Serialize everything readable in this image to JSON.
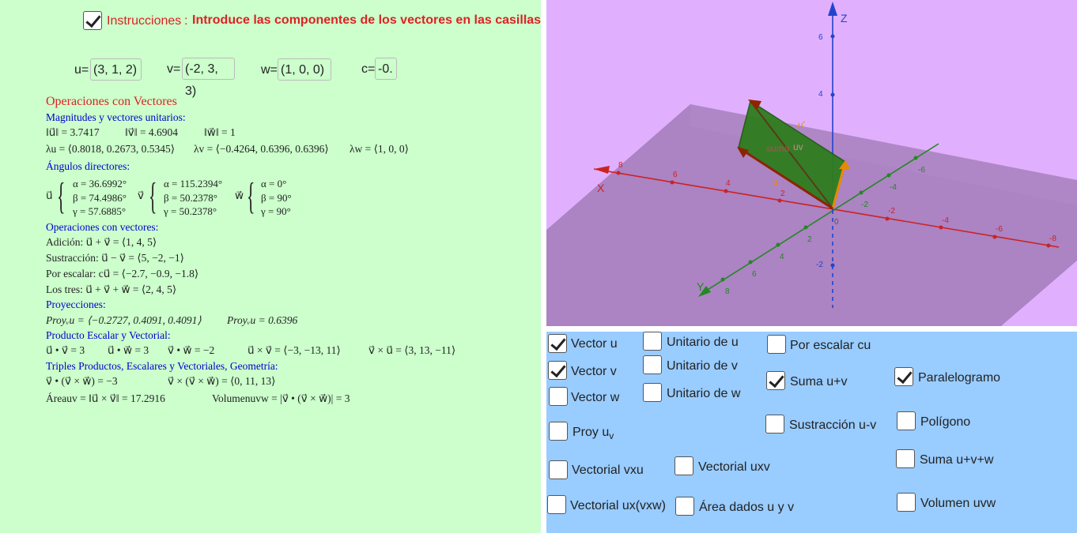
{
  "header": {
    "checkbox_checked": true,
    "label": "Instrucciones",
    "sep": ":",
    "instruction": "Introduce las componentes de los vectores en las casillas"
  },
  "inputs": [
    {
      "label": "u=",
      "value": "(3, 1, 2)"
    },
    {
      "label": "v=",
      "value": "(-2, 3, 3)"
    },
    {
      "label": "w=",
      "value": "(1, 0, 0)"
    },
    {
      "label": "c=",
      "value": "-0."
    }
  ],
  "ops": {
    "title": "Operaciones con Vectores",
    "magnitudes_title": "Magnitudes y vectores unitarios:",
    "mag_u": "‖u⃗‖ = 3.7417",
    "mag_v": "‖v⃗‖ = 4.6904",
    "mag_w": "‖w⃗‖ = 1",
    "lambda_u": "λu = ⟨0.8018, 0.2673, 0.5345⟩",
    "lambda_v": "λv = ⟨−0.4264, 0.6396, 0.6396⟩",
    "lambda_w": "λw = ⟨1, 0, 0⟩",
    "angles_title": "Ángulos directores:",
    "angles_u": [
      "α = 36.6992°",
      "β = 74.4986°",
      "γ = 57.6885°"
    ],
    "angles_v": [
      "α = 115.2394°",
      "β = 50.2378°",
      "γ = 50.2378°"
    ],
    "angles_w": [
      "α = 0°",
      "β = 90°",
      "γ = 90°"
    ],
    "vec_u": "u⃗",
    "vec_v": "v⃗",
    "vec_w": "w⃗",
    "opv_title": "Operaciones con vectores:",
    "add": "Adición: u⃗ + v⃗ = ⟨1, 4, 5⟩",
    "sub": "Sustracción: u⃗ − v⃗ = ⟨5, −2, −1⟩",
    "scalar": "Por escalar: cu⃗ = ⟨−2.7, −0.9, −1.8⟩",
    "three": "Los tres: u⃗ + v⃗ + w⃗ = ⟨2, 4, 5⟩",
    "proj_title": "Proyecciones:",
    "proj_vec": "Proyᵥu = ⟨−0.2727, 0.4091, 0.4091⟩",
    "proj_scalar": "Proyᵥu = 0.6396",
    "prod_title": "Producto Escalar y Vectorial:",
    "dot_uv": "u⃗ • v⃗ = 3",
    "dot_uw": "u⃗ • w⃗ = 3",
    "dot_vw": "v⃗ • w⃗ = −2",
    "cross_uv": "u⃗ × v⃗ = ⟨−3, −13, 11⟩",
    "cross_vu": "v⃗ × u⃗ = ⟨3, 13, −11⟩",
    "triple_title": "Triples Productos, Escalares y Vectoriales, Geometría:",
    "triple_dot": "v⃗ • (v⃗ × w⃗) = −3",
    "triple_cross": "v⃗ × (v⃗ × w⃗) = ⟨0, 11, 13⟩",
    "area": "Áreauv = ‖u⃗ × v⃗‖ = 17.2916",
    "volume": "Volumenuvw = |v⃗ • (v⃗ × w⃗)| = 3"
  },
  "view3d": {
    "axis_labels": {
      "x": "X",
      "y": "Y",
      "z": "Z"
    },
    "z_ticks": [
      "6",
      "4",
      "-2"
    ],
    "x_ticks": [
      "8",
      "6",
      "4",
      "2",
      "-2",
      "-4",
      "-6",
      "-8"
    ],
    "y_ticks": [
      "-6",
      "-4",
      "-2",
      "2",
      "4",
      "6",
      "8"
    ],
    "origin": "0",
    "vector_labels": {
      "u": "u",
      "u_prime": "u'",
      "suma": "suma",
      "uv": "uv"
    },
    "colors": {
      "x_axis": "#cc2222",
      "y_axis": "#228822",
      "z_axis": "#2244cc",
      "parallelogram": "#2e7d1e",
      "u_vector": "#e68a00",
      "v_vector": "#8b2500"
    }
  },
  "checkboxes": [
    {
      "id": "vector-u",
      "label": "Vector u",
      "checked": true
    },
    {
      "id": "unitario-u",
      "label": "Unitario de u",
      "checked": false
    },
    {
      "id": "por-escalar",
      "label": "Por escalar cu",
      "checked": false
    },
    {
      "id": "vector-v",
      "label": "Vector v",
      "checked": true
    },
    {
      "id": "unitario-v",
      "label": "Unitario de v",
      "checked": false
    },
    {
      "id": "suma-uv",
      "label": "Suma u+v",
      "checked": true
    },
    {
      "id": "paralelogramo",
      "label": "Paralelogramo",
      "checked": true
    },
    {
      "id": "vector-w",
      "label": "Vector w",
      "checked": false
    },
    {
      "id": "unitario-w",
      "label": "Unitario de w",
      "checked": false
    },
    {
      "id": "sustraccion",
      "label": "Sustracción u-v",
      "checked": false
    },
    {
      "id": "poligono",
      "label": "Polígono",
      "checked": false
    },
    {
      "id": "proy-uv",
      "label": "Proy u",
      "sub": "v",
      "checked": false
    },
    {
      "id": "suma-uvw",
      "label": "Suma u+v+w",
      "checked": false
    },
    {
      "id": "vectorial-vxu",
      "label": "Vectorial vxu",
      "checked": false
    },
    {
      "id": "vectorial-uxv",
      "label": "Vectorial uxv",
      "checked": false
    },
    {
      "id": "vectorial-uxvxw",
      "label": "Vectorial ux(vxw)",
      "checked": false
    },
    {
      "id": "area-uv",
      "label": "Área dados u y v",
      "checked": false
    },
    {
      "id": "volumen-uvw",
      "label": "Volumen uvw",
      "checked": false
    }
  ]
}
